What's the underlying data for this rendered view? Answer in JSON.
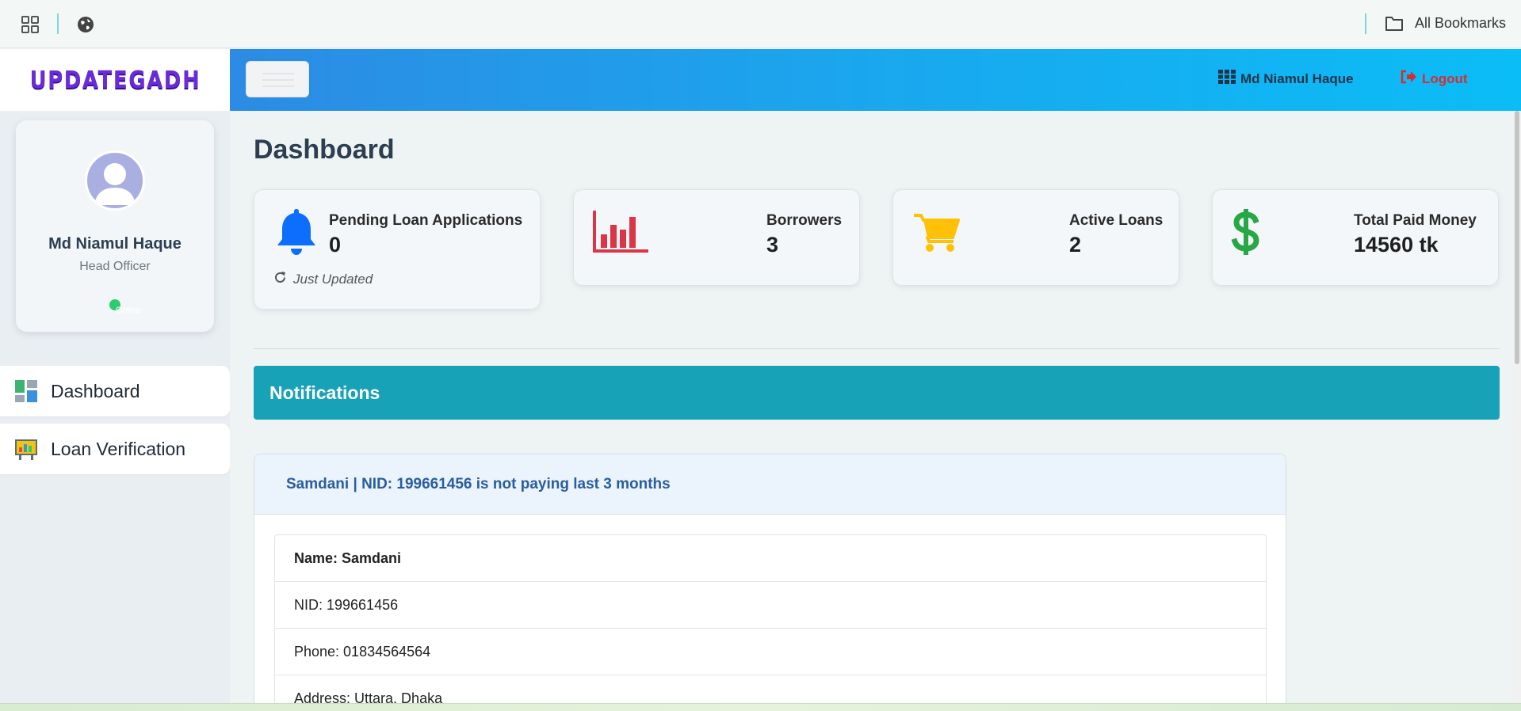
{
  "bookmarks_bar": {
    "all_bookmarks": "All Bookmarks"
  },
  "brand": {
    "logo_text": "UPDATEGADH"
  },
  "navbar": {
    "user_name": "Md Niamul Haque",
    "logout_label": "Logout"
  },
  "sidebar": {
    "profile": {
      "name": "Md Niamul Haque",
      "role": "Head Officer",
      "status": "Online"
    },
    "items": [
      {
        "label": "Dashboard",
        "icon": "dashboard-icon"
      },
      {
        "label": "Loan Verification",
        "icon": "presentation-chart-icon"
      }
    ]
  },
  "main": {
    "title": "Dashboard",
    "stats": [
      {
        "label": "Pending Loan Applications",
        "value": "0",
        "updated": "Just Updated",
        "icon": "bell-icon",
        "color": "#0d6efd"
      },
      {
        "label": "Borrowers",
        "value": "3",
        "icon": "bar-chart-icon",
        "color": "#dc3545"
      },
      {
        "label": "Active Loans",
        "value": "2",
        "icon": "shopping-cart-icon",
        "color": "#ffc107"
      },
      {
        "label": "Total Paid Money",
        "value": "14560 tk",
        "icon": "dollar-icon",
        "color": "#28a745"
      }
    ],
    "notifications": {
      "title": "Notifications",
      "alert": {
        "headline": "Samdani | NID: 199661456 is not paying last 3 months",
        "name": "Name: Samdani",
        "nid": "NID: 199661456",
        "phone": "Phone: 01834564564",
        "address": "Address: Uttara, Dhaka"
      }
    }
  }
}
